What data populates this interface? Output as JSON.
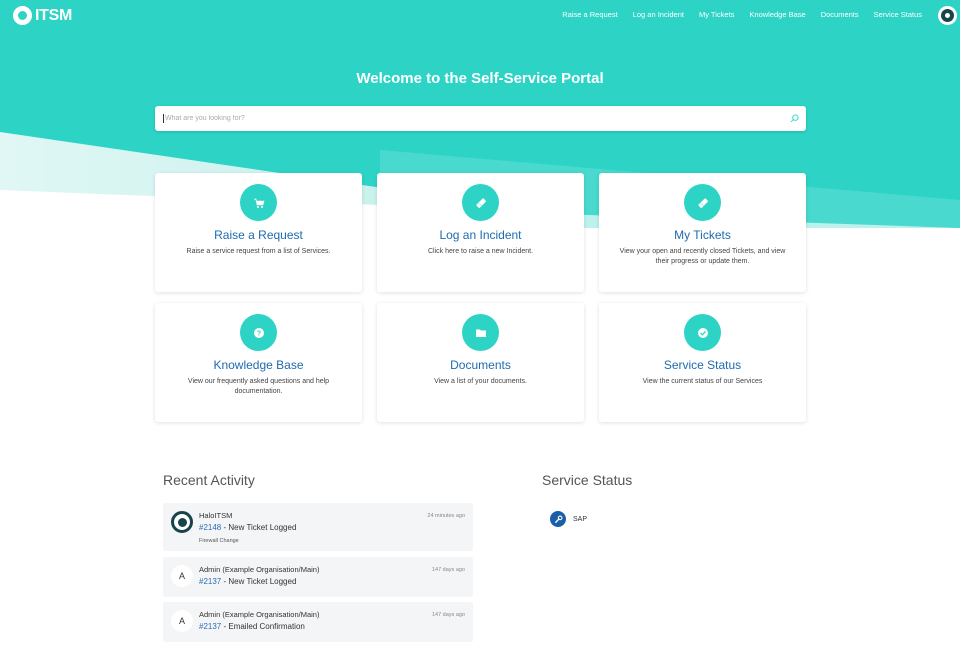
{
  "brand": {
    "name": "ITSM",
    "accent": "#2dd4c6",
    "link_color": "#1e6bb0"
  },
  "nav": {
    "items": [
      {
        "label": "Raise a Request"
      },
      {
        "label": "Log an Incident"
      },
      {
        "label": "My Tickets"
      },
      {
        "label": "Knowledge Base"
      },
      {
        "label": "Documents"
      },
      {
        "label": "Service Status"
      }
    ],
    "user_avatar_icon": "halo-user-icon"
  },
  "hero": {
    "title": "Welcome to the Self-Service Portal",
    "search_placeholder": "What are you looking for?",
    "search_icon": "search-icon"
  },
  "cards": [
    {
      "title": "Raise a Request",
      "description": "Raise a service request from a list of Services.",
      "icon": "cart-icon"
    },
    {
      "title": "Log an Incident",
      "description": "Click here to raise a new Incident.",
      "icon": "ticket-icon"
    },
    {
      "title": "My Tickets",
      "description": "View your open and recently closed Tickets, and view their progress or update them.",
      "icon": "ticket-icon"
    },
    {
      "title": "Knowledge Base",
      "description": "View our frequently asked questions and help documentation.",
      "icon": "question-icon"
    },
    {
      "title": "Documents",
      "description": "View a list of your documents.",
      "icon": "folder-icon"
    },
    {
      "title": "Service Status",
      "description": "View the current status of our Services",
      "icon": "check-icon"
    }
  ],
  "recent_activity": {
    "title": "Recent Activity",
    "items": [
      {
        "user": "HaloITSM",
        "avatar": "",
        "ticket": "#2148",
        "action": " - New Ticket Logged",
        "subtitle": "Firewall Change",
        "time": "24 minutes ago"
      },
      {
        "user": "Admin (Example Organisation/Main)",
        "avatar": "A",
        "ticket": "#2137",
        "action": " - New Ticket Logged",
        "subtitle": "",
        "time": "147 days ago"
      },
      {
        "user": "Admin (Example Organisation/Main)",
        "avatar": "A",
        "ticket": "#2137",
        "action": " - Emailed Confirmation",
        "subtitle": "",
        "time": "147 days ago"
      }
    ]
  },
  "service_status": {
    "title": "Service Status",
    "items": [
      {
        "name": "SAP",
        "icon": "wrench-icon",
        "color": "#1b5fa8"
      }
    ]
  }
}
